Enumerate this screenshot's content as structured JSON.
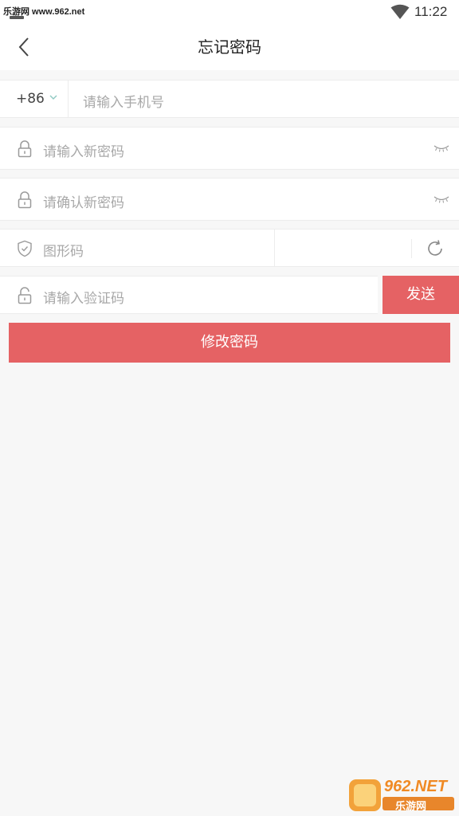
{
  "status_bar": {
    "watermark": "乐游网 www.962.net",
    "time": "11:22"
  },
  "header": {
    "title": "忘记密码"
  },
  "form": {
    "country_code": "+86",
    "phone_placeholder": "请输入手机号",
    "new_password_placeholder": "请输入新密码",
    "confirm_password_placeholder": "请确认新密码",
    "captcha_placeholder": "图形码",
    "sms_code_placeholder": "请输入验证码",
    "send_label": "发送",
    "submit_label": "修改密码"
  },
  "watermark_logo": {
    "brand": "962.NET",
    "name": "乐游网"
  },
  "colors": {
    "accent": "#e56264",
    "background": "#f7f7f7",
    "placeholder": "#a8a8a8"
  },
  "icons": [
    "back-arrow-icon",
    "chevron-down-icon",
    "lock-icon",
    "eye-closed-icon",
    "shield-check-icon",
    "refresh-icon",
    "wifi-icon"
  ]
}
